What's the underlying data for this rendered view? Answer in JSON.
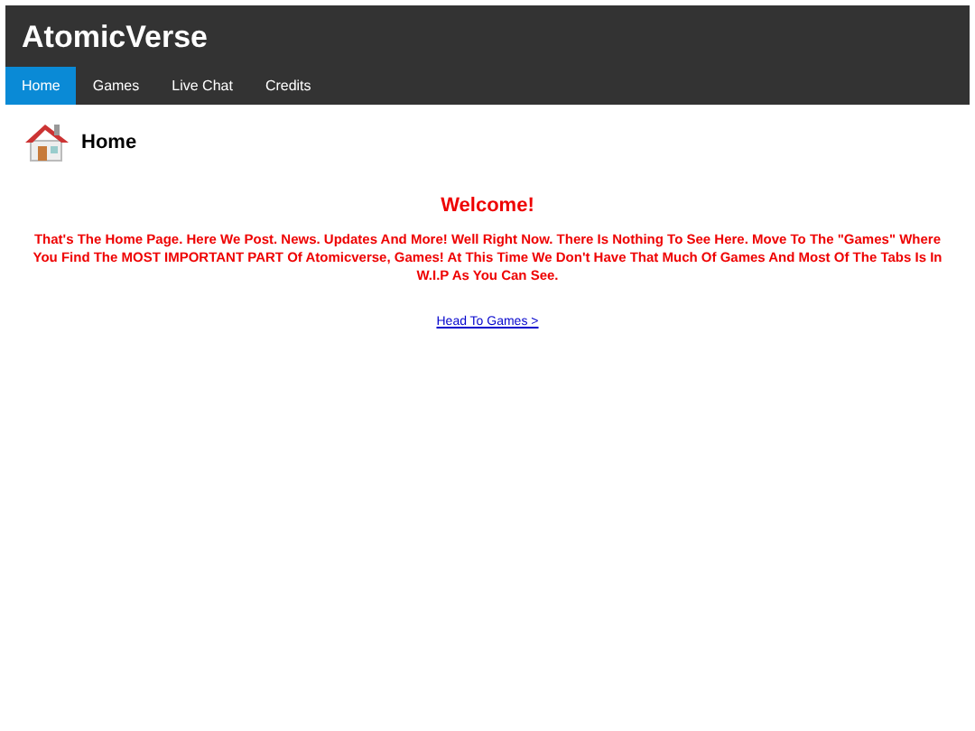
{
  "site_title": "AtomicVerse",
  "nav": [
    {
      "label": "Home",
      "selected": true
    },
    {
      "label": "Games",
      "selected": false
    },
    {
      "label": "Live Chat",
      "selected": false
    },
    {
      "label": "Credits",
      "selected": false
    }
  ],
  "page_title": "Home",
  "heading": "Welcome!",
  "body": "That's The Home Page. Here We Post. News. Updates And More! Well Right Now. There Is Nothing To See Here. Move To The \"Games\" Where You Find The MOST IMPORTANT PART Of Atomicverse, Games! At This Time We Don't Have That Much Of Games And Most Of The Tabs Is In W.I.P As You Can See.",
  "link": "Head To Games >"
}
